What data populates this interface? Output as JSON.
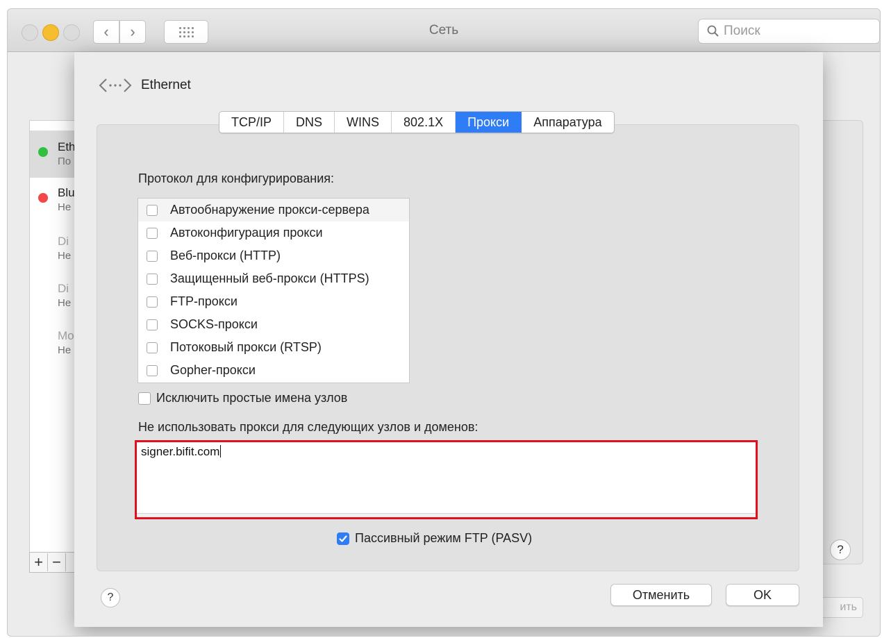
{
  "window": {
    "title": "Сеть"
  },
  "search": {
    "placeholder": "Поиск"
  },
  "background_services": [
    {
      "name": "Eth",
      "status": "По",
      "color": "#30c040"
    },
    {
      "name": "Blu",
      "status": "Не",
      "color": "#f24848"
    },
    {
      "name": "Di",
      "status": "Не",
      "color": ""
    },
    {
      "name": "Di",
      "status": "Не",
      "color": ""
    },
    {
      "name": "Mo",
      "status": "Не",
      "color": ""
    }
  ],
  "background_controls": {
    "add": "+",
    "remove": "−",
    "help": "?",
    "apply_partial": "ить"
  },
  "sheet": {
    "interface_name": "Ethernet",
    "tabs": [
      "TCP/IP",
      "DNS",
      "WINS",
      "802.1X",
      "Прокси",
      "Аппаратура"
    ],
    "active_tab": "Прокси",
    "protocol_label": "Протокол для конфигурирования:",
    "protocols": [
      {
        "label": "Автообнаружение прокси-сервера",
        "checked": false
      },
      {
        "label": "Автоконфигурация прокси",
        "checked": false
      },
      {
        "label": "Веб-прокси (HTTP)",
        "checked": false
      },
      {
        "label": "Защищенный веб-прокси (HTTPS)",
        "checked": false
      },
      {
        "label": "FTP-прокси",
        "checked": false
      },
      {
        "label": "SOCKS-прокси",
        "checked": false
      },
      {
        "label": "Потоковый прокси (RTSP)",
        "checked": false
      },
      {
        "label": "Gopher-прокси",
        "checked": false
      }
    ],
    "exclude_simple_hostnames": {
      "label": "Исключить простые имена узлов",
      "checked": false
    },
    "bypass_label": "Не использовать прокси для следующих узлов и доменов:",
    "bypass_value": "signer.bifit.com",
    "passive_ftp": {
      "label": "Пассивный режим FTP (PASV)",
      "checked": true
    },
    "help": "?",
    "cancel_label": "Отменить",
    "ok_label": "OK"
  },
  "colors": {
    "accent": "#2e7cf6",
    "highlight_border": "#e0101e"
  }
}
